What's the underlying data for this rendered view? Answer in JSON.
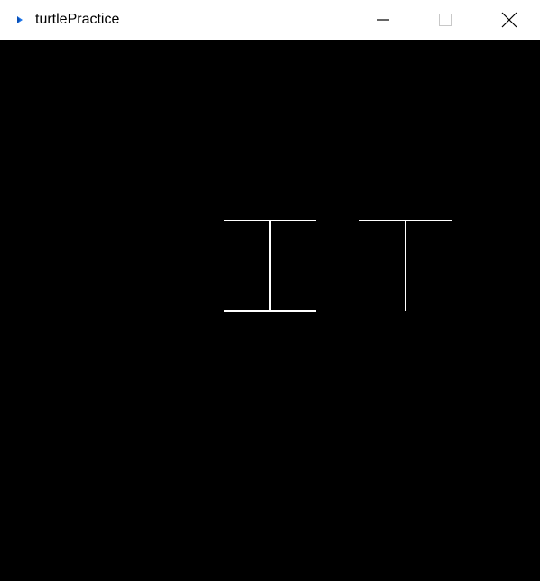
{
  "window": {
    "title": "turtlePractice",
    "background": "#000000",
    "titlebar_background": "#ffffff",
    "icon": "turtle-app-icon",
    "controls": [
      {
        "name": "minimize",
        "icon": "minimize-icon"
      },
      {
        "name": "maximize",
        "icon": "maximize-icon"
      },
      {
        "name": "close",
        "icon": "close-icon"
      }
    ]
  },
  "canvas": {
    "stroke_color": "#ffffff",
    "glyphs": [
      "I",
      "T"
    ]
  }
}
